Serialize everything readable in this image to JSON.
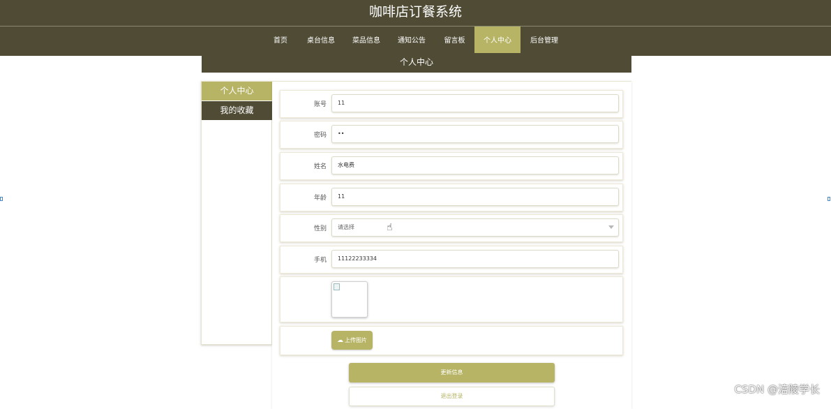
{
  "app": {
    "title": "咖啡店订餐系统"
  },
  "nav": {
    "items": [
      {
        "label": "首页"
      },
      {
        "label": "桌台信息"
      },
      {
        "label": "菜品信息"
      },
      {
        "label": "通知公告"
      },
      {
        "label": "留言板"
      },
      {
        "label": "个人中心",
        "active": true
      },
      {
        "label": "后台管理"
      }
    ]
  },
  "page": {
    "banner": "个人中心"
  },
  "sidebar": {
    "items": [
      {
        "label": "个人中心",
        "active": true
      },
      {
        "label": "我的收藏"
      }
    ]
  },
  "form": {
    "account": {
      "label": "账号",
      "value": "11"
    },
    "password": {
      "label": "密码",
      "value": "••"
    },
    "name": {
      "label": "姓名",
      "value": "水电费"
    },
    "age": {
      "label": "年龄",
      "value": "11"
    },
    "gender": {
      "label": "性别",
      "placeholder": "请选择"
    },
    "phone": {
      "label": "手机",
      "value": "11122233334"
    },
    "upload_label": "上传图片"
  },
  "actions": {
    "update": "更新信息",
    "logout": "退出登录"
  },
  "watermark": "CSDN @涪陵学长",
  "colors": {
    "header_bg": "#4f4b35",
    "accent": "#b7b465"
  },
  "icons": {
    "upload": "cloud-upload-icon",
    "cursor": "hand-pointer-icon",
    "select": "chevron-down-icon"
  }
}
